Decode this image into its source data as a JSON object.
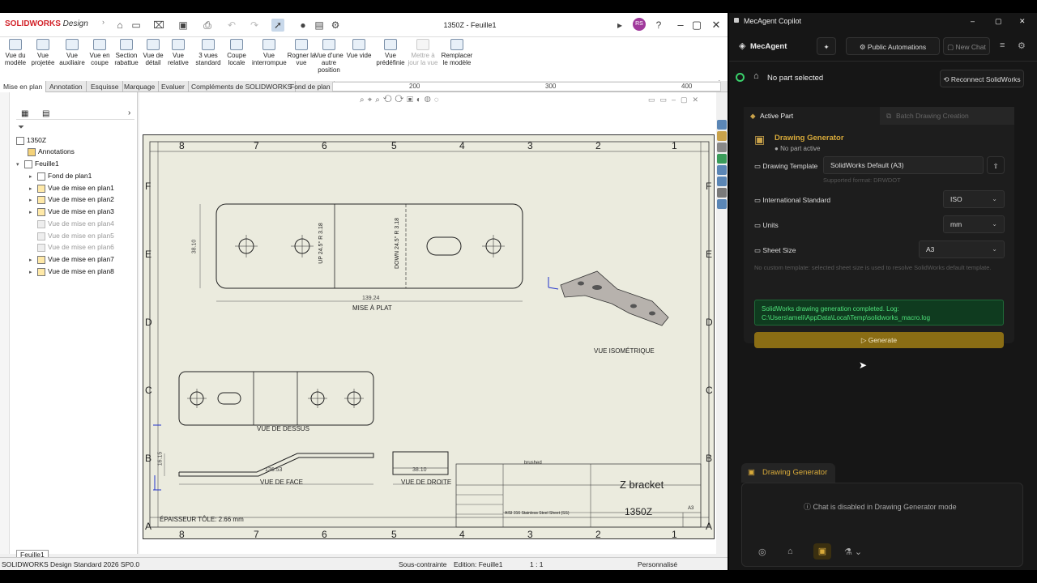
{
  "solidworks": {
    "app_name": "SOLIDWORKS",
    "app_suffix": "Design",
    "document_title": "1350Z - Feuille1",
    "ribbon": [
      {
        "label": "Vue du modèle"
      },
      {
        "label": "Vue projetée"
      },
      {
        "label": "Vue auxiliaire"
      },
      {
        "label": "Vue en coupe"
      },
      {
        "label": "Section rabattue"
      },
      {
        "label": "Vue de détail"
      },
      {
        "label": "Vue relative"
      },
      {
        "label": "3 vues standard"
      },
      {
        "label": "Coupe locale"
      },
      {
        "label": "Vue interrompue"
      },
      {
        "label": "Rogner la vue"
      },
      {
        "label": "Vue d'une autre position"
      },
      {
        "label": "Vue vide"
      },
      {
        "label": "Vue prédéfinie"
      },
      {
        "label": "Mettre à jour la vue"
      },
      {
        "label": "Remplacer le modèle"
      }
    ],
    "tabs": [
      "Mise en plan",
      "Annotation",
      "Esquisse",
      "Marquage",
      "Evaluer",
      "Compléments de SOLIDWORKS",
      "Fond de plan"
    ],
    "ruler_ticks": [
      "200",
      "300",
      "400"
    ],
    "tree": {
      "root": "1350Z",
      "annotations": "Annotations",
      "sheet": "Feuille1",
      "items": [
        {
          "label": "Fond de plan1",
          "dim": false
        },
        {
          "label": "Vue de mise en plan1",
          "dim": false
        },
        {
          "label": "Vue de mise en plan2",
          "dim": false
        },
        {
          "label": "Vue de mise en plan3",
          "dim": false
        },
        {
          "label": "Vue de mise en plan4",
          "dim": true
        },
        {
          "label": "Vue de mise en plan5",
          "dim": true
        },
        {
          "label": "Vue de mise en plan6",
          "dim": true
        },
        {
          "label": "Vue de mise en plan7",
          "dim": false
        },
        {
          "label": "Vue de mise en plan8",
          "dim": false
        }
      ]
    },
    "drawing": {
      "zones_top": [
        "8",
        "7",
        "6",
        "5",
        "4",
        "3",
        "2",
        "1"
      ],
      "zones_side": [
        "F",
        "E",
        "D",
        "C",
        "B",
        "A"
      ],
      "flat_label": "MISE À PLAT",
      "flat_dim_width": "139.24",
      "flat_dim_height": "38.10",
      "bend1": "UP 24.5° R 3.18",
      "bend2": "DOWN 24.5° R 3.18",
      "iso_label": "VUE ISOMÉTRIQUE",
      "top_label": "VUE DE DESSUS",
      "front_label": "VUE DE FACE",
      "front_dim": "136.53",
      "front_dim_h": "16.15",
      "right_label": "VUE DE DROITE",
      "right_dim": "38.10",
      "thickness": "ÉPAISSEUR TÔLE: 2.66 mm",
      "title_block": {
        "finish": "brushed",
        "material": "AISI 316 Stainless Steel Sheet (SS)",
        "title": "Z bracket",
        "drawing_number": "1350Z",
        "size": "A3"
      }
    },
    "sheet_tab": "Feuille1",
    "status": {
      "version": "SOLIDWORKS Design Standard 2026 SP0.0",
      "constraint": "Sous-contrainte",
      "edition": "Edition: Feuille1",
      "scale": "1 : 1",
      "mode": "Personnalisé"
    }
  },
  "mecagent": {
    "window_title": "MecAgent Copilot",
    "brand": "MecAgent",
    "public_automations": "Public Automations",
    "new_chat": "New Chat",
    "no_part": "No part selected",
    "reconnect": "Reconnect SolidWorks",
    "tab_active": "Active Part",
    "tab_batch": "Batch Drawing Creation",
    "gen_title": "Drawing Generator",
    "gen_sub": "No part active",
    "template_label": "Drawing Template",
    "template_value": "SolidWorks Default (A3)",
    "template_hint": "Supported format: DRWDOT",
    "standard_label": "International Standard",
    "standard_value": "ISO",
    "units_label": "Units",
    "units_value": "mm",
    "sheet_label": "Sheet Size",
    "sheet_value": "A3",
    "note": "No custom template: selected sheet size is used to resolve SolidWorks default template.",
    "success_line1": "SolidWorks drawing generation completed. Log:",
    "success_line2": "C:\\Users\\ameli\\AppData\\Local\\Temp\\solidworks_macro.log",
    "generate": "Generate",
    "mode_badge": "Drawing Generator",
    "chat_disabled": "Chat is disabled in Drawing Generator mode"
  },
  "colors": {
    "accent_gold": "#8a6d14",
    "success_green": "#4ee07a",
    "sheet_bg": "#ebebde"
  }
}
